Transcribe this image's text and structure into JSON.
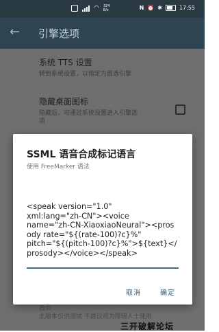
{
  "status_bar": {
    "data_speed": "324\nB/s",
    "time": "17:55"
  },
  "app_bar": {
    "title": "引擎选项"
  },
  "settings": [
    {
      "title": "系统 TTS 设置",
      "subtitle": "转到系统设置，以指定为首选引擎"
    },
    {
      "title": "隐藏桌面图标",
      "subtitle": "隐藏后，可通过系统设置进入引擎选\n项"
    }
  ],
  "background_text": {
    "faded_heading": "首页",
    "faded_line": "此版本仅供测试 不建议视为障碍人士使用"
  },
  "dialog": {
    "title": "SSML 语音合成标记语言",
    "subtitle": "使用 FreeMarker 语法",
    "input_value": "<speak version=\"1.0\"\nxml:lang=\"zh-CN\"><voice\nname=\"zh-CN-XiaoxiaoNeural\"><prosody rate=\"${(rate-100)?c}%\"\npitch=\"${(pitch-100)?c}%\">${text}</prosody></voice></speak>",
    "cancel_label": "取消",
    "ok_label": "确定"
  },
  "bottom_overlay": "三开破解论坛"
}
